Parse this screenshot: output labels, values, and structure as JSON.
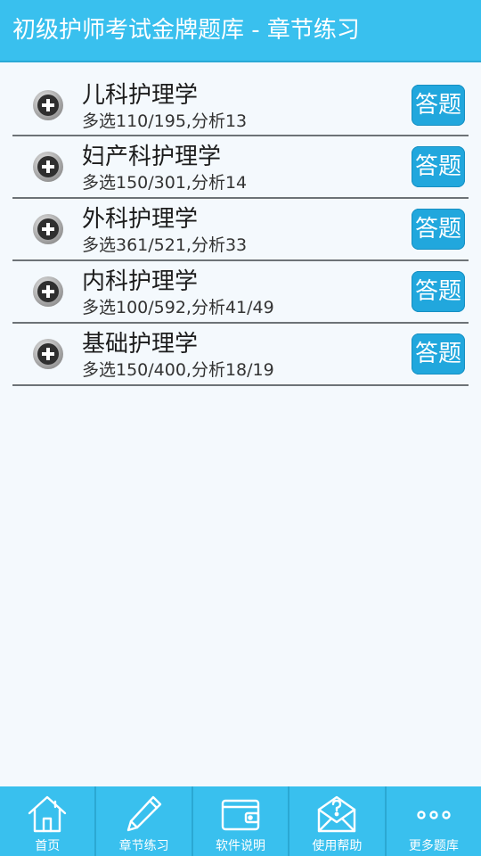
{
  "header": {
    "title": "初级护师考试金牌题库 - 章节练习"
  },
  "chapters": [
    {
      "name": "儿科护理学",
      "stats": "多选110/195,分析13",
      "action": "答题"
    },
    {
      "name": "妇产科护理学",
      "stats": "多选150/301,分析14",
      "action": "答题"
    },
    {
      "name": "外科护理学",
      "stats": "多选361/521,分析33",
      "action": "答题"
    },
    {
      "name": "内科护理学",
      "stats": "多选100/592,分析41/49",
      "action": "答题"
    },
    {
      "name": "基础护理学",
      "stats": "多选150/400,分析18/19",
      "action": "答题"
    }
  ],
  "nav": [
    {
      "label": "首页",
      "icon": "home-icon"
    },
    {
      "label": "章节练习",
      "icon": "pencil-icon"
    },
    {
      "label": "软件说明",
      "icon": "wallet-icon"
    },
    {
      "label": "使用帮助",
      "icon": "help-mail-icon"
    },
    {
      "label": "更多题库",
      "icon": "more-icon"
    }
  ],
  "colors": {
    "accent": "#39c0ee",
    "button": "#21a7dd",
    "background": "#f4f9fd"
  }
}
